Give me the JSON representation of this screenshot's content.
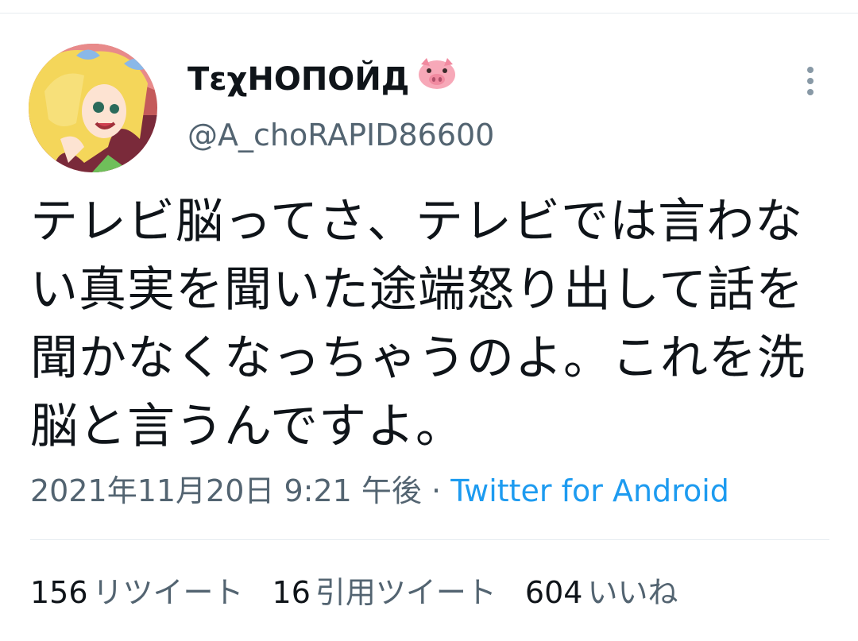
{
  "tweet": {
    "display_name": "TεχНОПОЙД",
    "name_emoji": "pig-face-icon",
    "username": "@A_choRAPID86600",
    "text": "テレビ脳ってさ、テレビでは言わない真実を聞いた途端怒り出して話を聞かなくなっちゃうのよ。これを洗脳と言うんですよ。",
    "timestamp": "2021年11月20日 9:21 午後",
    "separator": "·",
    "source": "Twitter for Android"
  },
  "stats": {
    "retweets_count": "156",
    "retweets_label": "リツイート",
    "quotes_count": "16",
    "quotes_label": "引用ツイート",
    "likes_count": "604",
    "likes_label": "いいね"
  },
  "colors": {
    "text_primary": "#0f1419",
    "text_secondary": "#536471",
    "link": "#1d9bf0",
    "divider": "#e6ecf0"
  }
}
